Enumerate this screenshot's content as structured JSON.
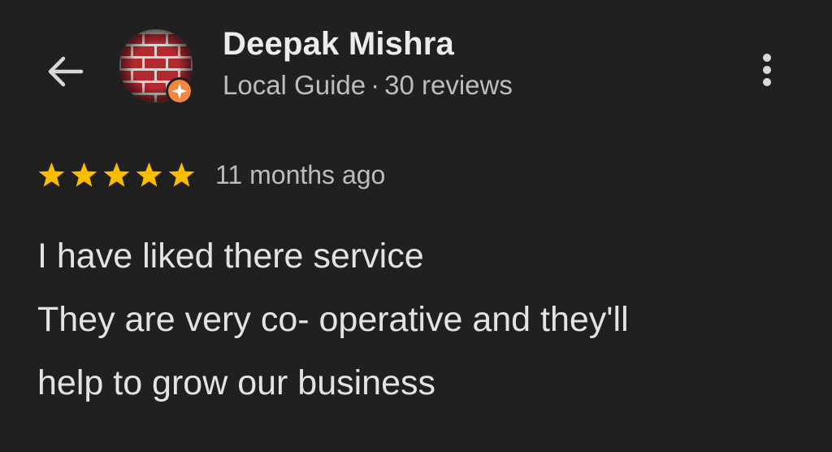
{
  "header": {
    "back_icon": "arrow-left-icon",
    "reviewer_name": "Deepak Mishra",
    "badge_label": "Local Guide",
    "separator": "·",
    "review_count": "30 reviews",
    "avatar_badge_icon": "local-guide-star-badge-icon",
    "more_icon": "more-vert-icon"
  },
  "rating": {
    "stars": 5,
    "max_stars": 5,
    "time_ago": "11 months ago"
  },
  "review": {
    "lines": [
      "I have liked there service",
      "They are very co- operative and they'll",
      "help to grow our business"
    ]
  },
  "colors": {
    "background": "#202020",
    "star": "#fbbc04",
    "badge": "#f5853f"
  }
}
